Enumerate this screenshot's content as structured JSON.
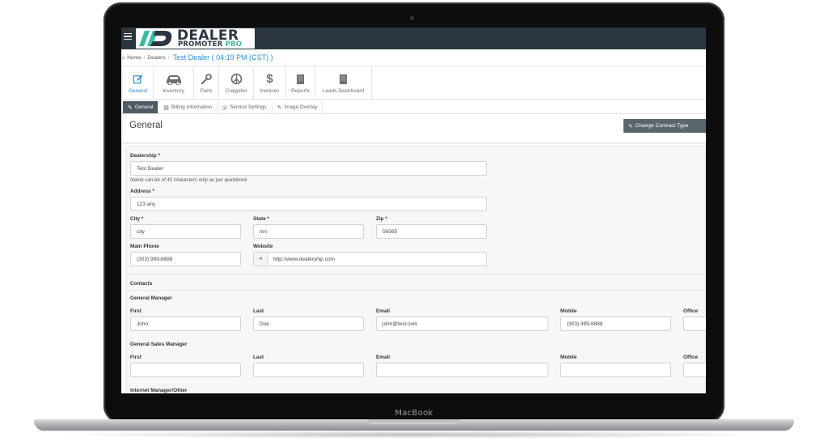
{
  "device": {
    "brand_label": "MacBook"
  },
  "app": {
    "logo_line1": "DEALER",
    "logo_line2a": "PROMOTER",
    "logo_line2b": "PRO",
    "accent_color": "#2a8fd0",
    "brand_teal": "#3bb9a3",
    "topbar_color": "#2b3640"
  },
  "breadcrumb": {
    "home": "Home",
    "dealers": "Dealers",
    "current": "Test Dealer ( 04:19 PM (CST) )"
  },
  "modules": [
    {
      "label": "General",
      "icon": "edit-icon",
      "active": true
    },
    {
      "label": "Inventory",
      "icon": "car-icon",
      "active": false
    },
    {
      "label": "Parts",
      "icon": "wrench-icon",
      "active": false
    },
    {
      "label": "Craigslist",
      "icon": "peace-icon",
      "active": false
    },
    {
      "label": "Invoices",
      "icon": "dollar-icon",
      "active": false
    },
    {
      "label": "Reports",
      "icon": "book-icon",
      "active": false
    },
    {
      "label": "Leads Dashboard",
      "icon": "book-icon",
      "active": false
    }
  ],
  "sub_tabs": [
    {
      "label": "General",
      "icon": "pencil-icon",
      "active": true
    },
    {
      "label": "Billing Information",
      "icon": "card-icon",
      "active": false
    },
    {
      "label": "Service Settings",
      "icon": "globe-icon",
      "active": false
    },
    {
      "label": "Image Overlay",
      "icon": "pencil-icon",
      "active": false
    }
  ],
  "page": {
    "title": "General",
    "change_contract_button": "Change Contract Type"
  },
  "form": {
    "dealership_label": "Dealership *",
    "dealership_value": "Test Dealer",
    "dealership_hint": "Name can be of 41 characters only as per quickbook",
    "address_label": "Address *",
    "address_value": "123 any",
    "city_label": "City *",
    "city_value": "city",
    "state_label": "State *",
    "state_value": "mn",
    "zip_label": "Zip *",
    "zip_value": "56565",
    "main_phone_label": "Main Phone",
    "main_phone_value": "(303) 999-8888",
    "website_label": "Website",
    "website_value": "http://www.dealership.com"
  },
  "contacts": {
    "heading": "Contacts",
    "general_manager": {
      "heading": "General Manager",
      "first_label": "First",
      "first_value": "John",
      "last_label": "Last",
      "last_value": "Doe",
      "email_label": "Email",
      "email_value": "john@test.com",
      "mobile_label": "Mobile",
      "mobile_value": "(303) 999-8888",
      "office_label": "Office"
    },
    "general_sales_manager": {
      "heading": "General Sales Manager",
      "first_label": "First",
      "last_label": "Last",
      "email_label": "Email",
      "mobile_label": "Mobile",
      "office_label": "Office"
    },
    "internet_manager_heading": "Internet Manager/Other"
  }
}
